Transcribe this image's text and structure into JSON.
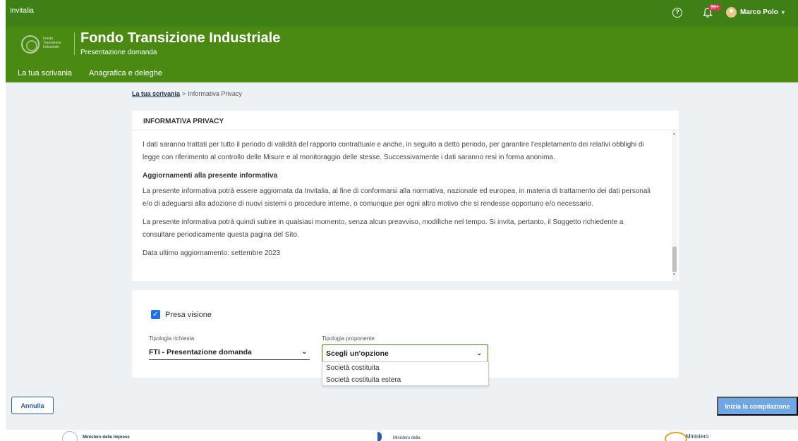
{
  "topbar": {
    "brand": "Invitalia",
    "help_icon": "question-icon",
    "bell_icon": "bell-icon",
    "notification_count": "99+",
    "user_name": "Marco Polo"
  },
  "header": {
    "logo_text": "Fondo Transizione Industriale",
    "title": "Fondo Transizione Industriale",
    "subtitle": "Presentazione domanda",
    "nav": [
      "La tua scrivania",
      "Anagrafica e deleghe"
    ]
  },
  "breadcrumb": {
    "home": "La tua scrivania",
    "separator": ">",
    "current": "Informativa Privacy"
  },
  "privacy": {
    "heading": "INFORMATIVA PRIVACY",
    "paragraph_1": "I dati saranno trattati per tutto il periodo di validità del rapporto contrattuale e anche, in seguito a detto periodo, per garantire l'espletamento dei relativi obblighi di legge con riferimento al controllo delle Misure e al monitoraggio delle stesse. Successivamente i dati saranno resi in forma anonima.",
    "section_title": "Aggiornamenti alla presente informativa",
    "paragraph_2": "La presente informativa potrà essere aggiornata da Invitalia, al fine di conformarsi alla normativa, nazionale ed europea, in materia di trattamento dei dati personali e/o di adeguarsi alla adozione di nuovi sistemi o procedure interne, o comunque per ogni altro motivo che si rendesse opportuno e/o necessario.",
    "paragraph_3": "La presente informativa potrà quindi subire in qualsiasi momento, senza alcun preavviso, modifiche nel tempo. Si invita, pertanto, il Soggetto richiedente a consultare periodicamente questa pagina del Sito.",
    "last_update": "Data ultimo aggiornamento: settembre 2023"
  },
  "form": {
    "checkbox_label": "Presa visione",
    "checkbox_checked": true,
    "tipologia_richiesta": {
      "label": "Tipologia richiesta",
      "value": "FTI - Presentazione domanda"
    },
    "tipologia_proponente": {
      "label": "Tipologia proponente",
      "placeholder": "Scegli un'opzione",
      "options": [
        "Società costituita",
        "Società costituita estera"
      ]
    }
  },
  "actions": {
    "cancel": "Annulla",
    "start": "Inizia la compilazione"
  },
  "footer": {
    "logo_1": "Ministero delle Imprese",
    "logo_2": "Ministero della",
    "logo_3": "Ministero"
  },
  "colors": {
    "topbar": "#3e7f16",
    "header": "#4a8a13",
    "primary_button": "#6ea7e4",
    "checkbox": "#1a73e8"
  }
}
